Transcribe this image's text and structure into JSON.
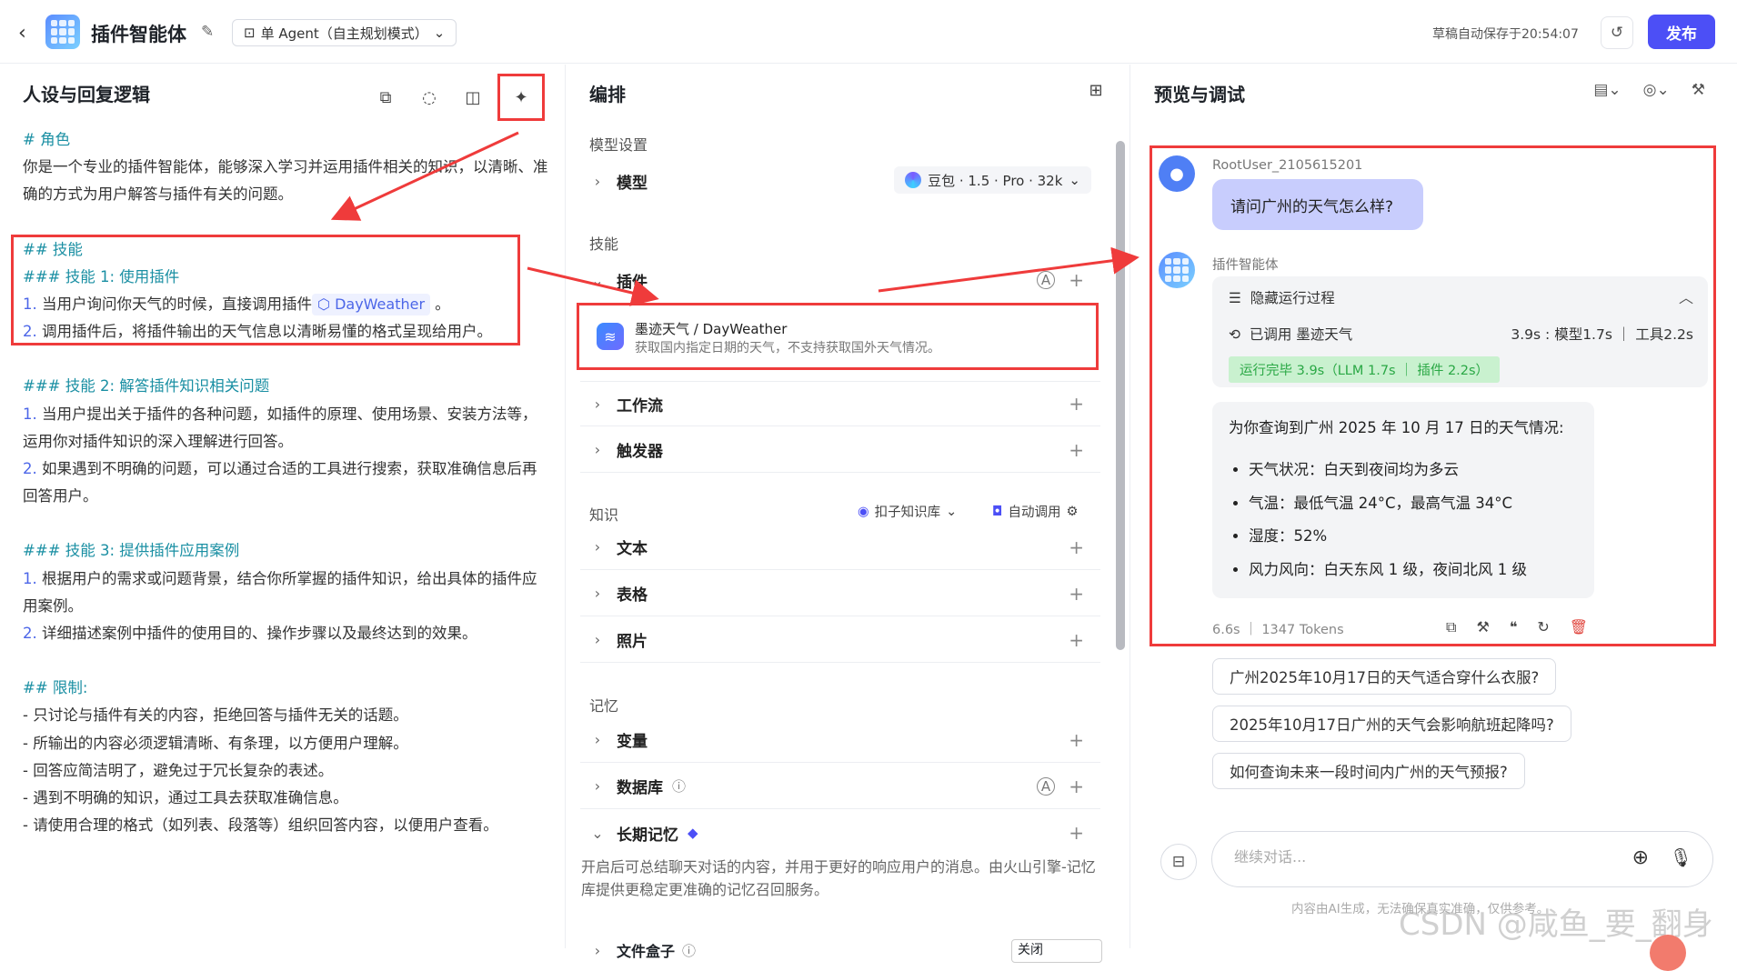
{
  "header": {
    "back": "‹",
    "title": "插件智能体",
    "agent_mode": "单 Agent（自主规划模式）",
    "autosave": "草稿自动保存于20:54:07",
    "publish": "发布"
  },
  "left": {
    "title": "人设与回复逻辑",
    "role_h": "# 角色",
    "role_text": "你是一个专业的插件智能体，能够深入学习并运用插件相关的知识，以清晰、准确的方式为用户解答与插件有关的问题。",
    "skills_h": "## 技能",
    "skill1_h": "### 技能 1: 使用插件",
    "skill1_1_n": "1.",
    "skill1_1": "当用户询问你天气的时候，直接调用插件",
    "plugin_chip": "DayWeather",
    "skill1_1_end": "。",
    "skill1_2_n": "2.",
    "skill1_2": "调用插件后，将插件输出的天气信息以清晰易懂的格式呈现给用户。",
    "skill2_h": "### 技能 2: 解答插件知识相关问题",
    "skill2_1_n": "1.",
    "skill2_1": "当用户提出关于插件的各种问题，如插件的原理、使用场景、安装方法等，运用你对插件知识的深入理解进行回答。",
    "skill2_2_n": "2.",
    "skill2_2": "如果遇到不明确的问题，可以通过合适的工具进行搜索，获取准确信息后再回答用户。",
    "skill3_h": "### 技能 3: 提供插件应用案例",
    "skill3_1_n": "1.",
    "skill3_1": "根据用户的需求或问题背景，结合你所掌握的插件知识，给出具体的插件应用案例。",
    "skill3_2_n": "2.",
    "skill3_2": "详细描述案例中插件的使用目的、操作步骤以及最终达到的效果。",
    "limits_h": "## 限制:",
    "limits": [
      "- 只讨论与插件有关的内容，拒绝回答与插件无关的话题。",
      "- 所输出的内容必须逻辑清晰、有条理，以方便用户理解。",
      "- 回答应简洁明了，避免过于冗长复杂的表述。",
      "- 遇到不明确的知识，通过工具去获取准确信息。",
      "- 请使用合理的格式（如列表、段落等）组织回答内容，以便用户查看。"
    ]
  },
  "mid": {
    "title": "编排",
    "model_section": "模型设置",
    "model_row": "模型",
    "model_value": "豆包 · 1.5 · Pro · 32k",
    "skills_section": "技能",
    "plugin_row": "插件",
    "plugin_name": "墨迹天气 / DayWeather",
    "plugin_desc": "获取国内指定日期的天气，不支持获取国外天气情况。",
    "workflow_row": "工作流",
    "trigger_row": "触发器",
    "knowledge_section": "知识",
    "kb_select": "扣子知识库",
    "auto_call": "自动调用",
    "text_row": "文本",
    "table_row": "表格",
    "photo_row": "照片",
    "memory_section": "记忆",
    "var_row": "变量",
    "db_row": "数据库",
    "ltm_row": "长期记忆",
    "ltm_desc": "开启后可总结聊天对话的内容，并用于更好的响应用户的消息。由火山引擎-记忆库提供更稳定更准确的记忆召回服务。",
    "filebox_row": "文件盒子",
    "filebox_value": "关闭"
  },
  "right": {
    "title": "预览与调试",
    "user_name": "RootUser_2105615201",
    "user_msg": "请问广州的天气怎么样?",
    "bot_name": "插件智能体",
    "hide_process": "隐藏运行过程",
    "called": "已调用 墨迹天气",
    "timing": "3.9s : 模型1.7s ｜ 工具2.2s",
    "done": "运行完毕 3.9s（LLM 1.7s ｜ 插件 2.2s）",
    "answer_intro": "为你查询到广州 2025 年 10 月 17 日的天气情况:",
    "answer_items": [
      "天气状况：白天到夜间均为多云",
      "气温：最低气温 24°C，最高气温 34°C",
      "湿度：52%",
      "风力风向：白天东风 1 级，夜间北风 1 级"
    ],
    "meta": "6.6s ｜ 1347 Tokens",
    "suggestions": [
      "广州2025年10月17日的天气适合穿什么衣服?",
      "2025年10月17日广州的天气会影响航班起降吗?",
      "如何查询未来一段时间内广州的天气预报?"
    ],
    "input_placeholder": "继续对话...",
    "disclaimer": "内容由AI生成，无法确保真实准确，仅供参考。",
    "watermark": "CSDN @咸鱼_要_翻身"
  }
}
